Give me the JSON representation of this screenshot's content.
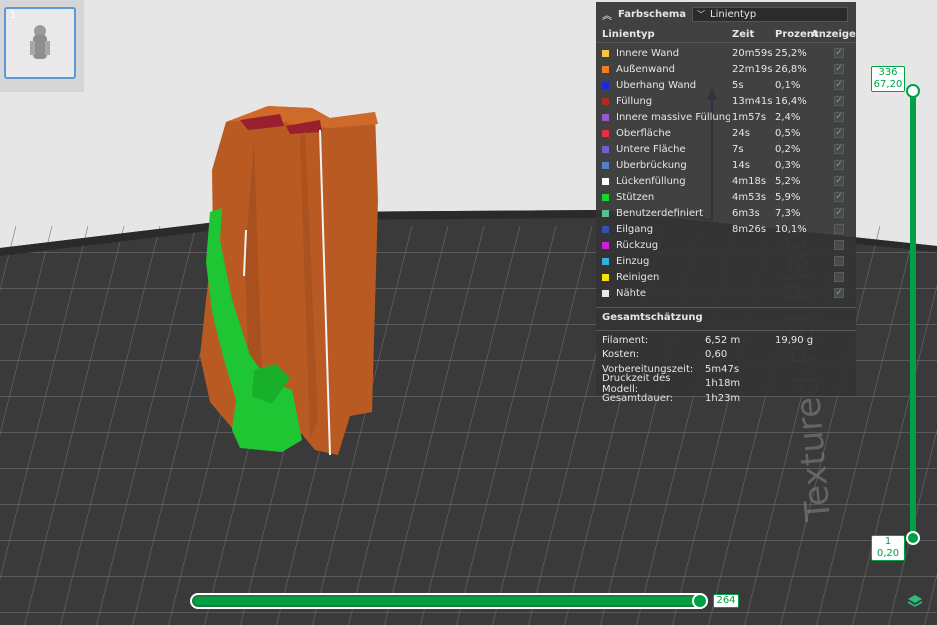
{
  "thumbnail": {
    "index": "1"
  },
  "legend": {
    "header_title": "Farbschema",
    "select_value": "Linientyp",
    "columns": {
      "name": "Linientyp",
      "time": "Zeit",
      "percent": "Prozent",
      "show": "Anzeigen"
    },
    "rows": [
      {
        "label": "Innere Wand",
        "color": "#f5c542",
        "time": "20m59s",
        "percent": "25,2%",
        "checked": true
      },
      {
        "label": "Außenwand",
        "color": "#f07c2a",
        "time": "22m19s",
        "percent": "26,8%",
        "checked": true
      },
      {
        "label": "Überhang Wand",
        "color": "#1c25e0",
        "time": "5s",
        "percent": "0,1%",
        "checked": true
      },
      {
        "label": "Füllung",
        "color": "#a8301f",
        "time": "13m41s",
        "percent": "16,4%",
        "checked": true
      },
      {
        "label": "Innere massive Füllung",
        "color": "#9a57c9",
        "time": "1m57s",
        "percent": "2,4%",
        "checked": true
      },
      {
        "label": "Oberfläche",
        "color": "#e3304a",
        "time": "24s",
        "percent": "0,5%",
        "checked": true
      },
      {
        "label": "Untere Fläche",
        "color": "#6f5fd1",
        "time": "7s",
        "percent": "0,2%",
        "checked": true
      },
      {
        "label": "Überbrückung",
        "color": "#4f83c4",
        "time": "14s",
        "percent": "0,3%",
        "checked": true
      },
      {
        "label": "Lückenfüllung",
        "color": "#ffffff",
        "time": "4m18s",
        "percent": "5,2%",
        "checked": true
      },
      {
        "label": "Stützen",
        "color": "#19d62b",
        "time": "4m53s",
        "percent": "5,9%",
        "checked": true
      },
      {
        "label": "Benutzerdefiniert",
        "color": "#5bbf8a",
        "time": "6m3s",
        "percent": "7,3%",
        "checked": true
      },
      {
        "label": "Eilgang",
        "color": "#3a4fa8",
        "time": "8m26s",
        "percent": "10,1%",
        "checked": false
      },
      {
        "label": "Rückzug",
        "color": "#d21fd3",
        "time": "",
        "percent": "",
        "checked": false
      },
      {
        "label": "Einzug",
        "color": "#3ab0d8",
        "time": "",
        "percent": "",
        "checked": false
      },
      {
        "label": "Reinigen",
        "color": "#f5e012",
        "time": "",
        "percent": "",
        "checked": false
      },
      {
        "label": "Nähte",
        "color": "#e8e8e8",
        "time": "",
        "percent": "",
        "checked": true
      }
    ],
    "estimate_title": "Gesamtschätzung",
    "estimates": [
      {
        "label": "Filament:",
        "value": "6,52 m",
        "extra": "19,90 g"
      },
      {
        "label": "Kosten:",
        "value": "0,60",
        "extra": ""
      },
      {
        "label": "Vorbereitungszeit:",
        "value": "5m47s",
        "extra": ""
      },
      {
        "label": "Druckzeit des Modell:",
        "value": "1h18m",
        "extra": ""
      },
      {
        "label": "Gesamtdauer:",
        "value": "1h23m",
        "extra": ""
      }
    ]
  },
  "vertical_slider": {
    "top_layer": "336",
    "top_height": "67,20",
    "bottom_layer": "1",
    "bottom_height": "0,20"
  },
  "horizontal_slider": {
    "value": "264"
  },
  "bed_text": "Textured PEI Plate",
  "colors": {
    "accent": "#00a046"
  }
}
